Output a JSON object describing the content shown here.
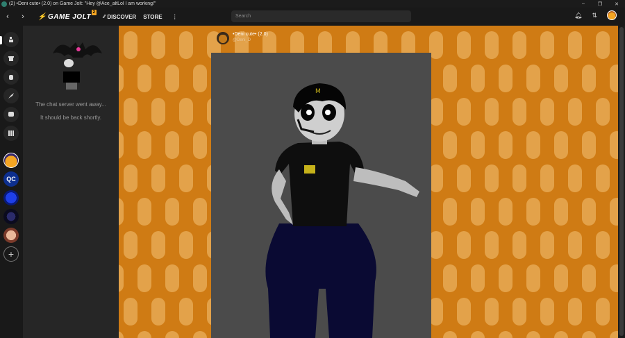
{
  "window": {
    "title": "(2) •Deni cute• (2.0) on Game Jolt: \"Hey @Ace_altLol I am working!\"",
    "controls": [
      "–",
      "❐",
      "✕"
    ]
  },
  "nav": {
    "back": "‹",
    "forward": "›",
    "logo_text": "GAME JOLT",
    "logo_badge": "2",
    "discover_label": "DISCOVER",
    "store_label": "STORE",
    "more_label": "⋮",
    "search_placeholder": "Search",
    "icons": [
      "bell-icon",
      "friends-icon",
      "user-avatar"
    ]
  },
  "rail": {
    "icons": [
      "home-icon",
      "store-icon",
      "backpack-icon",
      "creator-icon",
      "chat-icon",
      "library-icon"
    ],
    "communities": [
      {
        "name": "orange-avatar",
        "text": ""
      },
      {
        "name": "qc-community",
        "text": "QC"
      },
      {
        "name": "blue-community",
        "text": ""
      },
      {
        "name": "dark-community",
        "text": ""
      },
      {
        "name": "pink-community",
        "text": ""
      }
    ],
    "add_label": "+"
  },
  "chat": {
    "line1": "The chat server went away...",
    "line2": "It should be back shortly."
  },
  "post": {
    "title": "•Deni cute• (2.0)",
    "username": "@Deni_D"
  },
  "colors": {
    "accent": "#f5a623",
    "background_orange": "#d07a14",
    "pill_light": "#e3a24a",
    "artwork_bg": "#4b4b4b"
  }
}
